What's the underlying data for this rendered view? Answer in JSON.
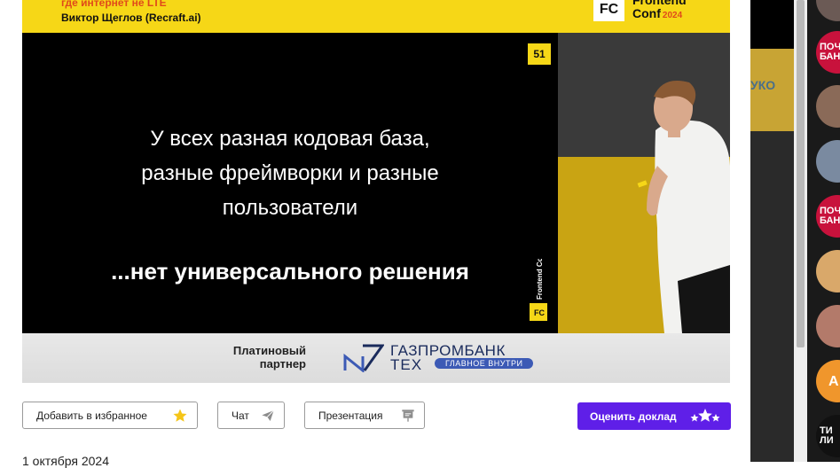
{
  "video": {
    "banner_subtitle": "где интернет не LTE",
    "banner_speaker": "Виктор Щеглов (Recraft.ai)",
    "conf_logo_short": "FC",
    "conf_name_line1": "Frontend",
    "conf_name_line2": "Conf",
    "conf_year": "2024",
    "slide_number": "51",
    "slide_text": "У всех разная кодовая база,\nразные фреймворки и разные\nпользователи",
    "slide_bold_text": "...нет универсального решения"
  },
  "sponsor": {
    "label": "Платиновый\nпартнер",
    "brand_line1": "ГАЗПРОМБАНК",
    "brand_line2": "ТЕХ",
    "brand_tagline": "ГЛАВНОЕ ВНУТРИ"
  },
  "actions": {
    "favorite_label": "Добавить в избранное",
    "chat_label": "Чат",
    "presentation_label": "Презентация",
    "rate_label": "Оценить доклад"
  },
  "date": "1 октября 2024",
  "gutter": {
    "partial_text": "УКО"
  },
  "sidebar": {
    "items": [
      {
        "label": "",
        "color": "#6b5a55"
      },
      {
        "label": "ПОЧ\nБАН",
        "color": "#c8123c"
      },
      {
        "label": "",
        "color": "#8a6a58"
      },
      {
        "label": "",
        "color": "#7a8aa0"
      },
      {
        "label": "ПОЧ\nБАН",
        "color": "#c8123c"
      },
      {
        "label": "",
        "color": "#d9a86a"
      },
      {
        "label": "",
        "color": "#b37a6a"
      },
      {
        "label": "А",
        "color": "#f0962c"
      },
      {
        "label": "ТИ\nЛИ",
        "color": "#111111"
      }
    ]
  },
  "colors": {
    "accent": "#5f1fe8",
    "banner_yellow": "#f6d717",
    "star": "#f5c518"
  }
}
